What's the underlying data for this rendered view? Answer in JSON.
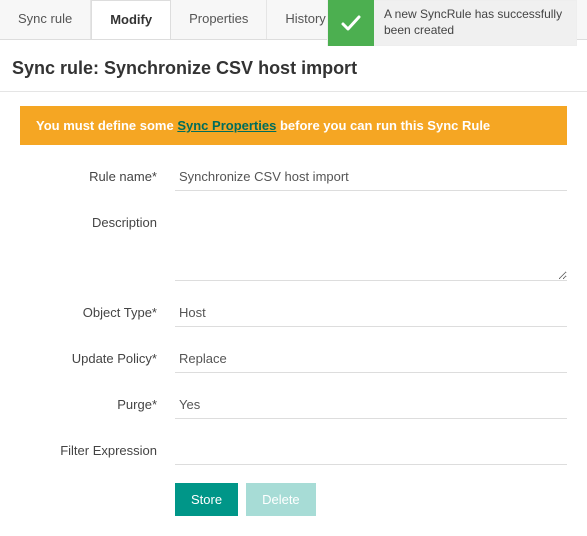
{
  "tabs": {
    "items": [
      {
        "label": "Sync rule"
      },
      {
        "label": "Modify"
      },
      {
        "label": "Properties"
      },
      {
        "label": "History"
      }
    ]
  },
  "toast": {
    "message": "A new SyncRule has successfully been created"
  },
  "page": {
    "title": "Sync rule: Synchronize CSV host import"
  },
  "warning": {
    "prefix": "You must define some ",
    "link_text": "Sync Properties",
    "suffix": " before you can run this Sync Rule"
  },
  "form": {
    "rule_name": {
      "label": "Rule name*",
      "value": "Synchronize CSV host import"
    },
    "description": {
      "label": "Description",
      "value": ""
    },
    "object_type": {
      "label": "Object Type*",
      "value": "Host"
    },
    "update_policy": {
      "label": "Update Policy*",
      "value": "Replace"
    },
    "purge": {
      "label": "Purge*",
      "value": "Yes"
    },
    "filter_expression": {
      "label": "Filter Expression",
      "value": ""
    }
  },
  "actions": {
    "store": "Store",
    "delete": "Delete"
  }
}
